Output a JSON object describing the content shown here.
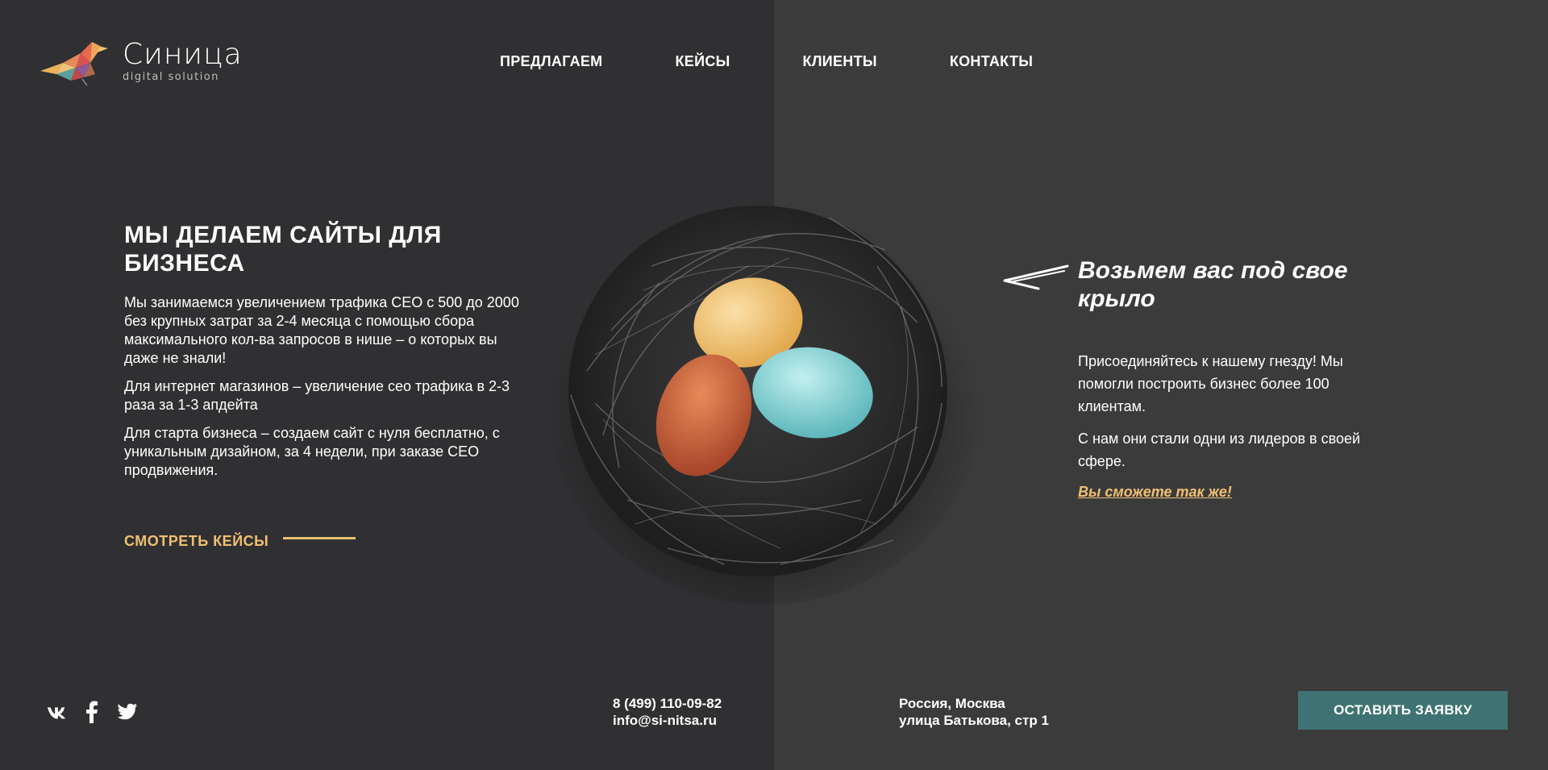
{
  "brand": {
    "name": "Синица",
    "tagline": "digital solution",
    "colors": {
      "accent": "#f0c072",
      "button": "#3f7373",
      "bg_left": "#303032",
      "bg_right": "#3b3b3b"
    }
  },
  "nav": {
    "items": [
      {
        "label": "ПРЕДЛАГАЕМ"
      },
      {
        "label": "КЕЙСЫ"
      },
      {
        "label": "КЛИЕНТЫ"
      },
      {
        "label": "КОНТАКТЫ"
      }
    ]
  },
  "hero": {
    "title": "МЫ ДЕЛАЕМ САЙТЫ ДЛЯ БИЗНЕСА",
    "paragraphs": [
      "Мы занимаемся увеличением трафика СЕО с 500 до 2000 без крупных затрат за 2-4 месяца с помощью сбора максимального кол-ва запросов в нише – о которых вы даже не знали!",
      "Для интернет магазинов – увеличение сео трафика в 2-3 раза за 1-3 апдейта",
      "Для старта бизнеса – создаем сайт с нуля бесплатно, с уникальным дизайном, за 4 недели, при заказе СЕО продвижения."
    ],
    "cta_label": "СМОТРЕТЬ КЕЙСЫ"
  },
  "wing": {
    "title": "Возьмем вас под свое крыло",
    "paragraphs": [
      "Присоединяйтесь к нашему гнезду! Мы помогли построить бизнес более 100 клиентам.",
      "С нам они стали одни из лидеров в своей сфере."
    ],
    "link_label": "Вы сможете так же!"
  },
  "footer": {
    "socials": [
      "vk-icon",
      "facebook-icon",
      "twitter-icon"
    ],
    "phone": "8 (499) 110-09-82",
    "email": "info@si-nitsa.ru",
    "address_line1": "Россия, Москва",
    "address_line2": "улица Батькова, стр 1",
    "order_button": "ОСТАВИТЬ ЗАЯВКУ"
  }
}
